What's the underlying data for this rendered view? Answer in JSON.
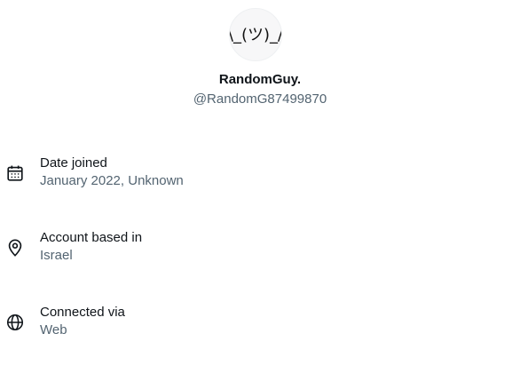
{
  "profile": {
    "avatar_text": "\\_(ツ)_/",
    "display_name": "RandomGuy.",
    "handle": "@RandomG87499870"
  },
  "details": [
    {
      "icon": "calendar-icon",
      "label": "Date joined",
      "value": "January 2022, Unknown"
    },
    {
      "icon": "location-pin-icon",
      "label": "Account based in",
      "value": "Israel"
    },
    {
      "icon": "globe-icon",
      "label": "Connected via",
      "value": "Web"
    }
  ]
}
